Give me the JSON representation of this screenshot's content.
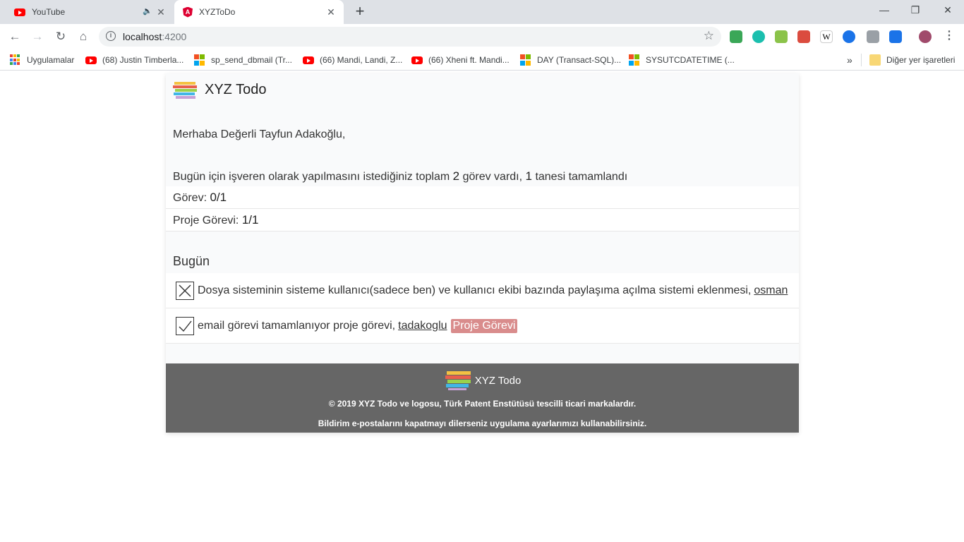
{
  "browser": {
    "tabs": [
      {
        "title": "YouTube"
      },
      {
        "title": "XYZToDo"
      }
    ],
    "address": {
      "host": "localhost",
      "port": ":4200"
    },
    "bookmarks": [
      {
        "label": "Uygulamalar"
      },
      {
        "label": "(68) Justin Timberla..."
      },
      {
        "label": "sp_send_dbmail (Tr..."
      },
      {
        "label": "(66) Mandi, Landi, Z..."
      },
      {
        "label": "(66) Xheni ft. Mandi..."
      },
      {
        "label": "DAY (Transact-SQL)..."
      },
      {
        "label": "SYSUTCDATETIME (..."
      }
    ],
    "other_bookmarks": "Diğer yer işaretleri"
  },
  "app": {
    "brand": "XYZ Todo",
    "greeting": "Merhaba Değerli Tayfun Adakoğlu,",
    "summary": {
      "prefix": "Bugün için işveren olarak yapılmasını istediğiniz toplam",
      "total": "2",
      "middle": "görev vardı,",
      "done": "1",
      "suffix": "tanesi tamamlandı"
    },
    "stats": [
      {
        "label": "Görev:",
        "value": "0/1"
      },
      {
        "label": "Proje Görevi:",
        "value": "1/1"
      }
    ],
    "section_title": "Bugün",
    "tasks": [
      {
        "text": "Dosya sisteminin sisteme kullanıcı(sadece ben) ve kullanıcı ekibi bazında paylaşıma açılma sistemi eklenmesi,",
        "user": "osman",
        "badge": "",
        "completed": false
      },
      {
        "text": "email görevi tamamlanıyor proje görevi,",
        "user": "tadakoglu",
        "badge": "Proje Görevi",
        "completed": true
      }
    ],
    "footer": {
      "brand": "XYZ Todo",
      "copyright": "© 2019 XYZ Todo ve logosu, Türk Patent Enstütüsü tescilli ticari markalardır.",
      "notice": "Bildirim e-postalarını kapatmayı dilerseniz uygulama ayarlarımızı kullanabilirsiniz."
    }
  }
}
